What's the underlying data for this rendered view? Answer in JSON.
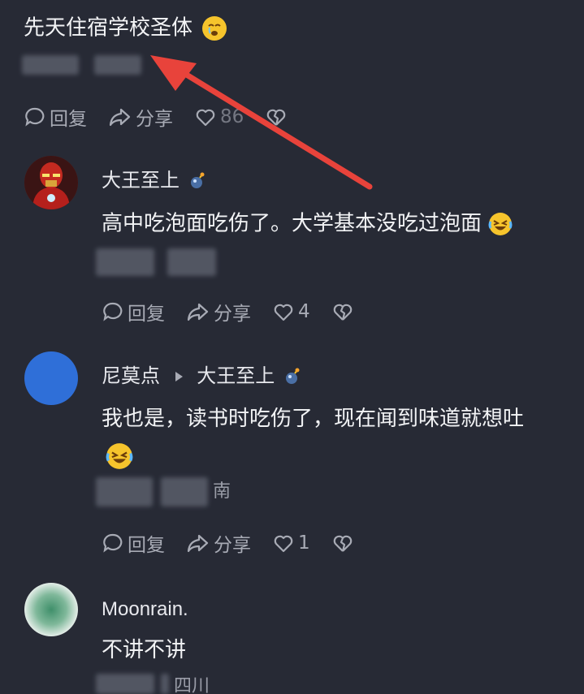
{
  "top_comment": {
    "text": "先天住宿学校圣体",
    "actions": {
      "reply_label": "回复",
      "share_label": "分享",
      "like_count": "86"
    }
  },
  "comments": [
    {
      "username": "大王至上",
      "text": "高中吃泡面吃伤了。大学基本没吃过泡面",
      "actions": {
        "reply_label": "回复",
        "share_label": "分享",
        "like_count": "4"
      }
    },
    {
      "username": "尼莫点",
      "reply_to": "大王至上",
      "text_line1": "我也是，读书时吃伤了，现在闻到味道就想吐",
      "location": "南",
      "actions": {
        "reply_label": "回复",
        "share_label": "分享",
        "like_count": "1"
      }
    },
    {
      "username": "Moonrain.",
      "text": "不讲不讲",
      "location": "四川"
    }
  ],
  "colors": {
    "background": "#272a35",
    "arrow": "#e8433b",
    "avatar_blue": "#2f6fd8",
    "text": "#f2f3f5",
    "muted": "#a8abb5"
  },
  "icons": [
    "reply-icon",
    "share-icon",
    "heart-icon",
    "broken-heart-icon",
    "crying-emoji-icon",
    "laughing-crying-emoji-icon",
    "bomb-badge-icon",
    "play-arrow-icon"
  ]
}
